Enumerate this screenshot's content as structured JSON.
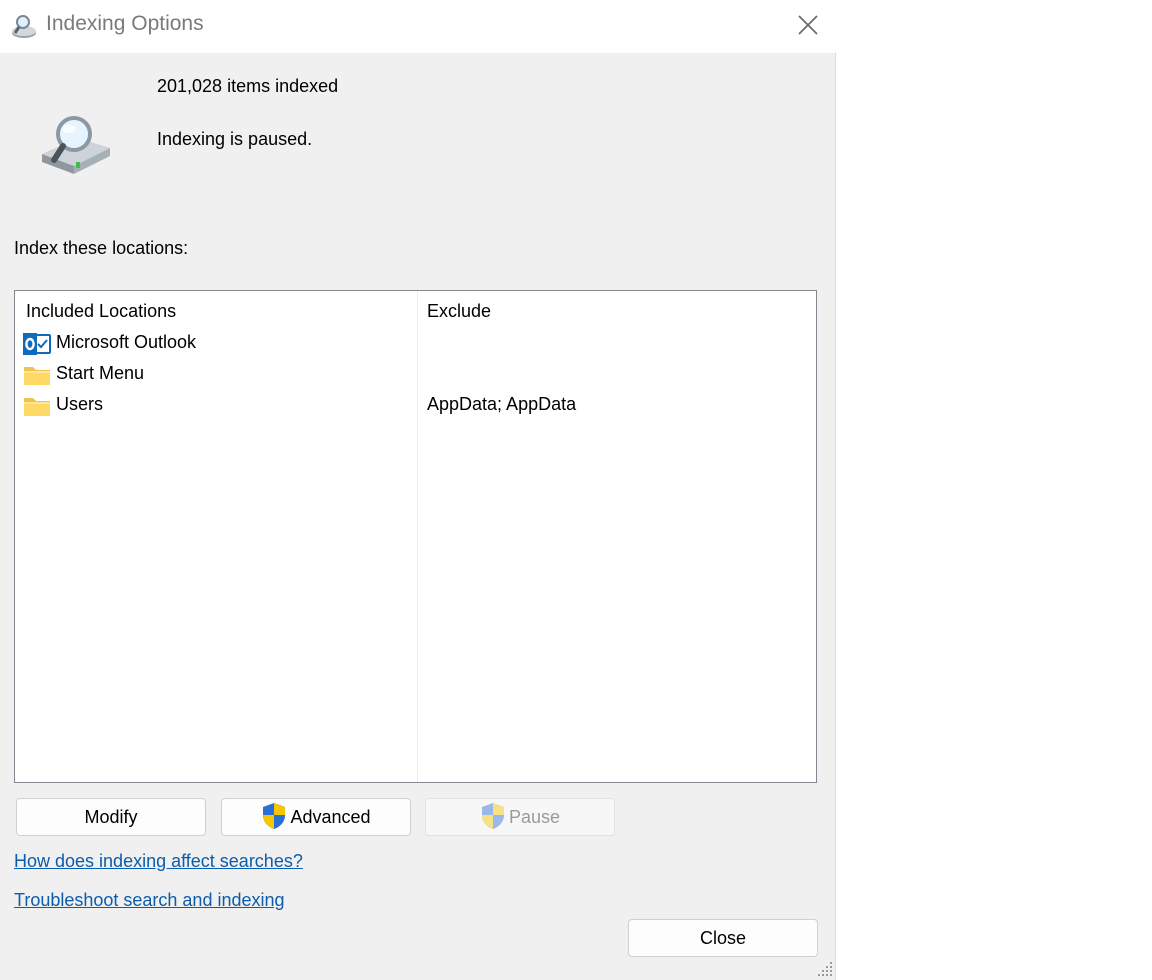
{
  "window": {
    "title": "Indexing Options"
  },
  "status": {
    "items_indexed": "201,028 items indexed",
    "state": "Indexing is paused."
  },
  "locations": {
    "label": "Index these locations:",
    "columns": [
      "Included Locations",
      "Exclude"
    ],
    "rows": [
      {
        "name": "Microsoft Outlook",
        "exclude": "",
        "icon": "outlook-icon"
      },
      {
        "name": "Start Menu",
        "exclude": "",
        "icon": "folder-icon"
      },
      {
        "name": "Users",
        "exclude": "AppData; AppData",
        "icon": "folder-icon"
      }
    ]
  },
  "buttons": {
    "modify": "Modify",
    "advanced": "Advanced",
    "pause": "Pause",
    "close": "Close"
  },
  "links": {
    "help": "How does indexing affect searches?",
    "troubleshoot": "Troubleshoot search and indexing"
  },
  "colors": {
    "link": "#0b5cad",
    "folder": "#ffd75e",
    "outlook": "#0f6cbd",
    "shield_blue": "#2a6fd6",
    "shield_yellow": "#f6c700"
  }
}
